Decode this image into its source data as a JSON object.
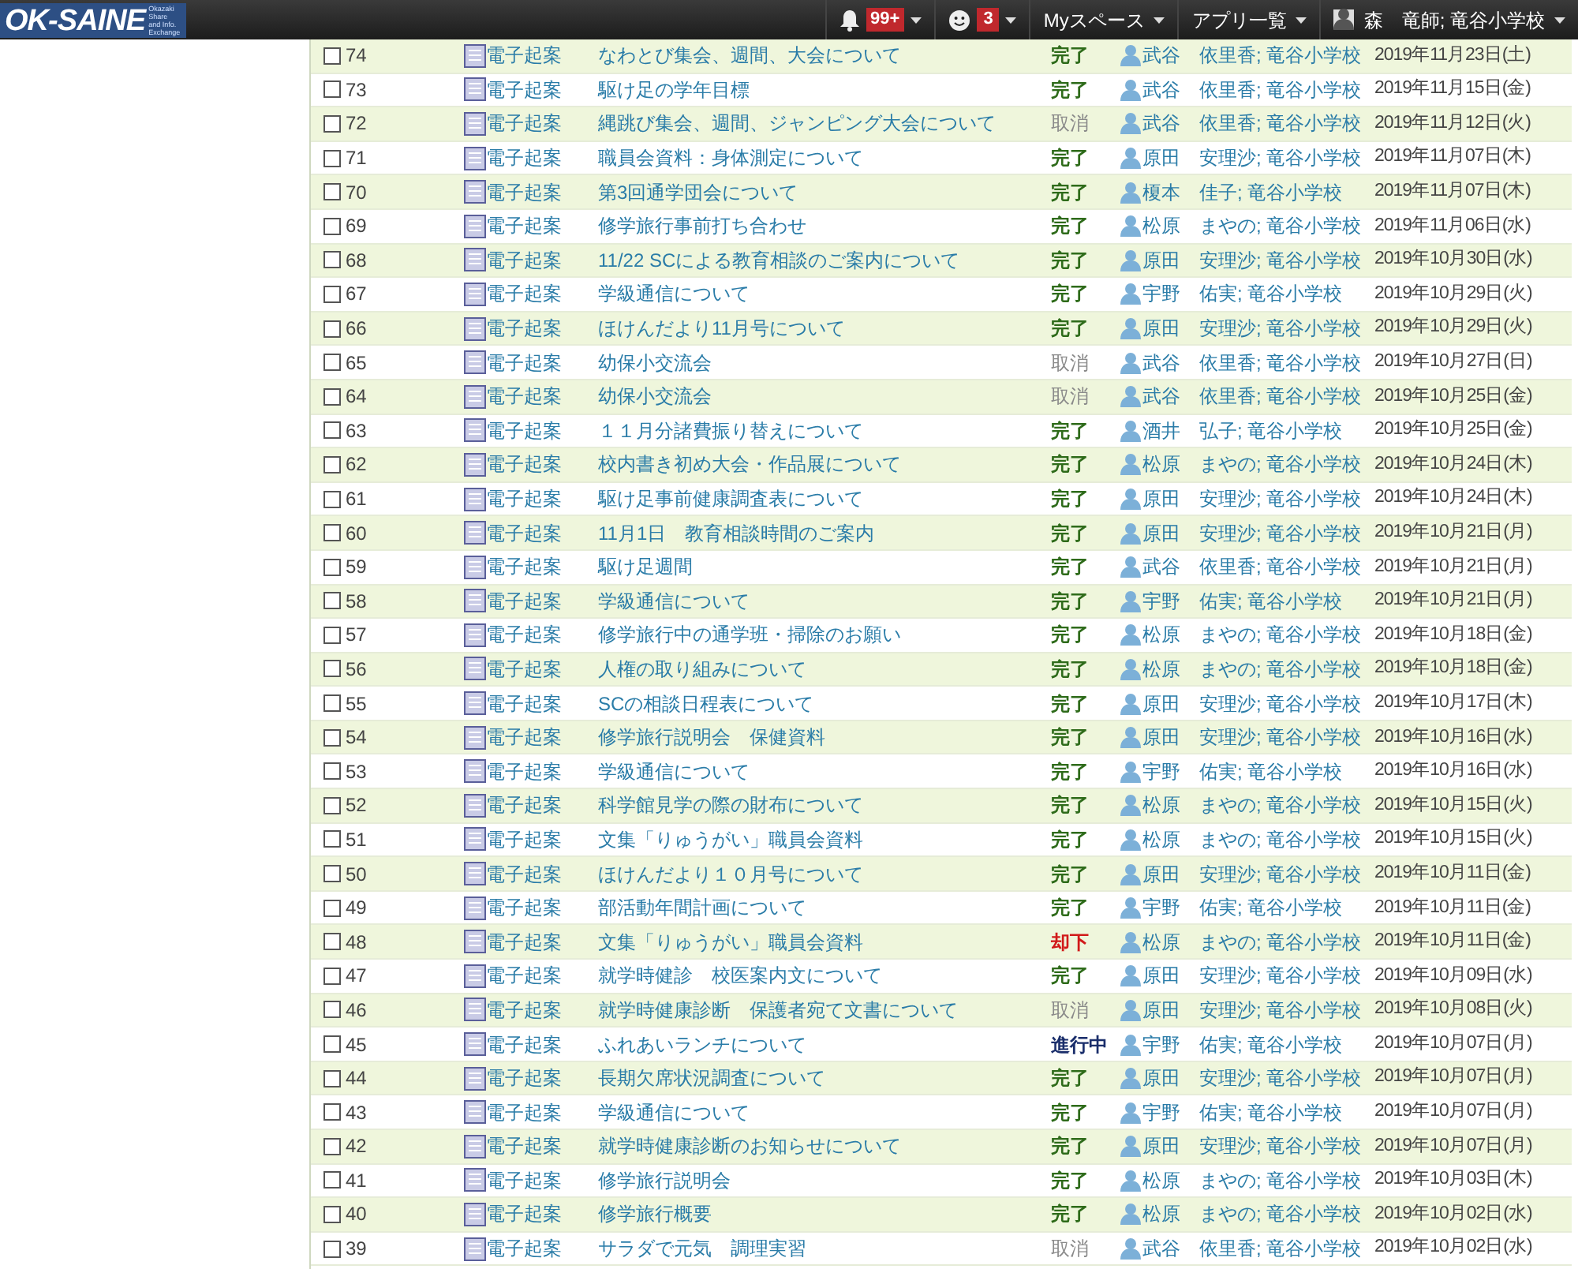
{
  "header": {
    "logo": "OK-SAINE",
    "logo_subtitle": [
      "Okazaki",
      "Share",
      "and Info.",
      "Exchange"
    ],
    "notifications": "99+",
    "messages": "3",
    "menus": [
      {
        "label": "Myスペース"
      },
      {
        "label": "アプリ一覧"
      }
    ],
    "user": "森　竜師; 竜谷小学校"
  },
  "rows": [
    {
      "no": "74",
      "checked": false,
      "type": "電子起案",
      "title": "なわとび集会、週間、大会について",
      "status": "完了",
      "kind": "done",
      "person": "武谷　依里香; 竜谷小学校",
      "date": "2019年11月23日(土)"
    },
    {
      "no": "73",
      "checked": false,
      "type": "電子起案",
      "title": "駆け足の学年目標",
      "status": "完了",
      "kind": "done",
      "person": "武谷　依里香; 竜谷小学校",
      "date": "2019年11月15日(金)"
    },
    {
      "no": "72",
      "checked": false,
      "type": "電子起案",
      "title": "縄跳び集会、週間、ジャンピング大会について",
      "status": "取消",
      "kind": "cancelled",
      "person": "武谷　依里香; 竜谷小学校",
      "date": "2019年11月12日(火)"
    },
    {
      "no": "71",
      "checked": false,
      "type": "電子起案",
      "title": "職員会資料：身体測定について",
      "status": "完了",
      "kind": "done",
      "person": "原田　安理沙; 竜谷小学校",
      "date": "2019年11月07日(木)"
    },
    {
      "no": "70",
      "checked": false,
      "type": "電子起案",
      "title": "第3回通学団会について",
      "status": "完了",
      "kind": "done",
      "person": "榎本　佳子; 竜谷小学校",
      "date": "2019年11月07日(木)"
    },
    {
      "no": "69",
      "checked": false,
      "type": "電子起案",
      "title": "修学旅行事前打ち合わせ",
      "status": "完了",
      "kind": "done",
      "person": "松原　まやの; 竜谷小学校",
      "date": "2019年11月06日(水)"
    },
    {
      "no": "68",
      "checked": false,
      "type": "電子起案",
      "title": "11/22 SCによる教育相談のご案内について",
      "status": "完了",
      "kind": "done",
      "person": "原田　安理沙; 竜谷小学校",
      "date": "2019年10月30日(水)"
    },
    {
      "no": "67",
      "checked": false,
      "type": "電子起案",
      "title": "学級通信について",
      "status": "完了",
      "kind": "done",
      "person": "宇野　佑実; 竜谷小学校",
      "date": "2019年10月29日(火)"
    },
    {
      "no": "66",
      "checked": false,
      "type": "電子起案",
      "title": "ほけんだより11月号について",
      "status": "完了",
      "kind": "done",
      "person": "原田　安理沙; 竜谷小学校",
      "date": "2019年10月29日(火)"
    },
    {
      "no": "65",
      "checked": false,
      "type": "電子起案",
      "title": "幼保小交流会",
      "status": "取消",
      "kind": "cancelled",
      "person": "武谷　依里香; 竜谷小学校",
      "date": "2019年10月27日(日)"
    },
    {
      "no": "64",
      "checked": false,
      "type": "電子起案",
      "title": "幼保小交流会",
      "status": "取消",
      "kind": "cancelled",
      "person": "武谷　依里香; 竜谷小学校",
      "date": "2019年10月25日(金)"
    },
    {
      "no": "63",
      "checked": false,
      "type": "電子起案",
      "title": "１１月分諸費振り替えについて",
      "status": "完了",
      "kind": "done",
      "person": "酒井　弘子; 竜谷小学校",
      "date": "2019年10月25日(金)"
    },
    {
      "no": "62",
      "checked": false,
      "type": "電子起案",
      "title": "校内書き初め大会・作品展について",
      "status": "完了",
      "kind": "done",
      "person": "松原　まやの; 竜谷小学校",
      "date": "2019年10月24日(木)"
    },
    {
      "no": "61",
      "checked": false,
      "type": "電子起案",
      "title": "駆け足事前健康調査表について",
      "status": "完了",
      "kind": "done",
      "person": "原田　安理沙; 竜谷小学校",
      "date": "2019年10月24日(木)"
    },
    {
      "no": "60",
      "checked": false,
      "type": "電子起案",
      "title": "11月1日　教育相談時間のご案内",
      "status": "完了",
      "kind": "done",
      "person": "原田　安理沙; 竜谷小学校",
      "date": "2019年10月21日(月)"
    },
    {
      "no": "59",
      "checked": false,
      "type": "電子起案",
      "title": "駆け足週間",
      "status": "完了",
      "kind": "done",
      "person": "武谷　依里香; 竜谷小学校",
      "date": "2019年10月21日(月)"
    },
    {
      "no": "58",
      "checked": false,
      "type": "電子起案",
      "title": "学級通信について",
      "status": "完了",
      "kind": "done",
      "person": "宇野　佑実; 竜谷小学校",
      "date": "2019年10月21日(月)"
    },
    {
      "no": "57",
      "checked": false,
      "type": "電子起案",
      "title": "修学旅行中の通学班・掃除のお願い",
      "status": "完了",
      "kind": "done",
      "person": "松原　まやの; 竜谷小学校",
      "date": "2019年10月18日(金)"
    },
    {
      "no": "56",
      "checked": false,
      "type": "電子起案",
      "title": "人権の取り組みについて",
      "status": "完了",
      "kind": "done",
      "person": "松原　まやの; 竜谷小学校",
      "date": "2019年10月18日(金)"
    },
    {
      "no": "55",
      "checked": false,
      "type": "電子起案",
      "title": "SCの相談日程表について",
      "status": "完了",
      "kind": "done",
      "person": "原田　安理沙; 竜谷小学校",
      "date": "2019年10月17日(木)"
    },
    {
      "no": "54",
      "checked": false,
      "type": "電子起案",
      "title": "修学旅行説明会　保健資料",
      "status": "完了",
      "kind": "done",
      "person": "原田　安理沙; 竜谷小学校",
      "date": "2019年10月16日(水)"
    },
    {
      "no": "53",
      "checked": false,
      "type": "電子起案",
      "title": "学級通信について",
      "status": "完了",
      "kind": "done",
      "person": "宇野　佑実; 竜谷小学校",
      "date": "2019年10月16日(水)"
    },
    {
      "no": "52",
      "checked": false,
      "type": "電子起案",
      "title": "科学館見学の際の財布について",
      "status": "完了",
      "kind": "done",
      "person": "松原　まやの; 竜谷小学校",
      "date": "2019年10月15日(火)"
    },
    {
      "no": "51",
      "checked": false,
      "type": "電子起案",
      "title": "文集「りゅうがい」職員会資料",
      "status": "完了",
      "kind": "done",
      "person": "松原　まやの; 竜谷小学校",
      "date": "2019年10月15日(火)"
    },
    {
      "no": "50",
      "checked": false,
      "type": "電子起案",
      "title": "ほけんだより１０月号について",
      "status": "完了",
      "kind": "done",
      "person": "原田　安理沙; 竜谷小学校",
      "date": "2019年10月11日(金)"
    },
    {
      "no": "49",
      "checked": false,
      "type": "電子起案",
      "title": "部活動年間計画について",
      "status": "完了",
      "kind": "done",
      "person": "宇野　佑実; 竜谷小学校",
      "date": "2019年10月11日(金)"
    },
    {
      "no": "48",
      "checked": false,
      "type": "電子起案",
      "title": "文集「りゅうがい」職員会資料",
      "status": "却下",
      "kind": "rejected",
      "person": "松原　まやの; 竜谷小学校",
      "date": "2019年10月11日(金)"
    },
    {
      "no": "47",
      "checked": false,
      "type": "電子起案",
      "title": "就学時健診　校医案内文について",
      "status": "完了",
      "kind": "done",
      "person": "原田　安理沙; 竜谷小学校",
      "date": "2019年10月09日(水)"
    },
    {
      "no": "46",
      "checked": false,
      "type": "電子起案",
      "title": "就学時健康診断　保護者宛て文書について",
      "status": "取消",
      "kind": "cancelled",
      "person": "原田　安理沙; 竜谷小学校",
      "date": "2019年10月08日(火)"
    },
    {
      "no": "45",
      "checked": false,
      "type": "電子起案",
      "title": "ふれあいランチについて",
      "status": "進行中",
      "kind": "in_progress",
      "person": "宇野　佑実; 竜谷小学校",
      "date": "2019年10月07日(月)"
    },
    {
      "no": "44",
      "checked": false,
      "type": "電子起案",
      "title": "長期欠席状況調査について",
      "status": "完了",
      "kind": "done",
      "person": "原田　安理沙; 竜谷小学校",
      "date": "2019年10月07日(月)"
    },
    {
      "no": "43",
      "checked": false,
      "type": "電子起案",
      "title": "学級通信について",
      "status": "完了",
      "kind": "done",
      "person": "宇野　佑実; 竜谷小学校",
      "date": "2019年10月07日(月)"
    },
    {
      "no": "42",
      "checked": false,
      "type": "電子起案",
      "title": "就学時健康診断のお知らせについて",
      "status": "完了",
      "kind": "done",
      "person": "原田　安理沙; 竜谷小学校",
      "date": "2019年10月07日(月)"
    },
    {
      "no": "41",
      "checked": false,
      "type": "電子起案",
      "title": "修学旅行説明会",
      "status": "完了",
      "kind": "done",
      "person": "松原　まやの; 竜谷小学校",
      "date": "2019年10月03日(木)"
    },
    {
      "no": "40",
      "checked": false,
      "type": "電子起案",
      "title": "修学旅行概要",
      "status": "完了",
      "kind": "done",
      "person": "松原　まやの; 竜谷小学校",
      "date": "2019年10月02日(水)"
    },
    {
      "no": "39",
      "checked": false,
      "type": "電子起案",
      "title": "サラダで元気　調理実習",
      "status": "取消",
      "kind": "cancelled",
      "person": "武谷　依里香; 竜谷小学校",
      "date": "2019年10月02日(水)"
    }
  ]
}
